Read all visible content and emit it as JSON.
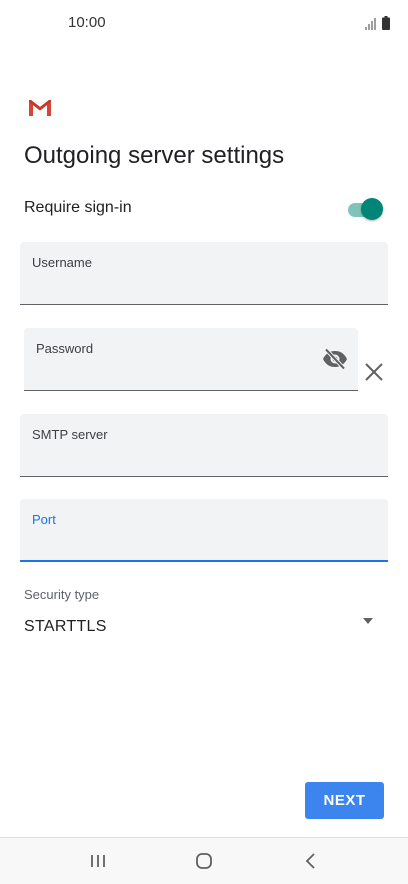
{
  "status_bar": {
    "time": "10:00",
    "icons": [
      "signal-icon",
      "battery-icon"
    ]
  },
  "app": {
    "logo": "gmail-logo-icon",
    "brand_color": "#d44638"
  },
  "page": {
    "title": "Outgoing server settings"
  },
  "require_signin": {
    "label": "Require sign-in",
    "enabled": true,
    "accent_color": "#008577"
  },
  "fields": {
    "username": {
      "label": "Username",
      "value": ""
    },
    "password": {
      "label": "Password",
      "value": "",
      "visibility_icon": "eye-off-icon",
      "clear_icon": "close-icon"
    },
    "smtp_server": {
      "label": "SMTP server",
      "value": ""
    },
    "port": {
      "label": "Port",
      "value": "",
      "focused": true,
      "focus_color": "#1a73e8"
    }
  },
  "security": {
    "label": "Security type",
    "selected": "STARTTLS",
    "icon": "dropdown-arrow-icon"
  },
  "actions": {
    "next_label": "NEXT",
    "next_color": "#3d85ee"
  },
  "nav_bar": {
    "buttons": [
      "recents-icon",
      "home-icon",
      "back-icon"
    ]
  }
}
